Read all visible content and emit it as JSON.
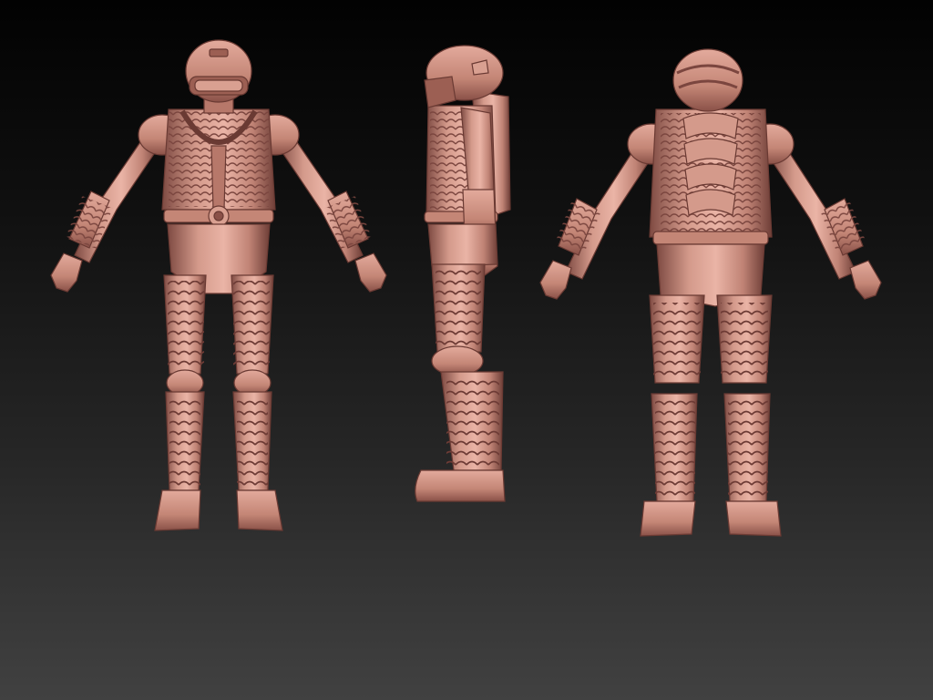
{
  "scene": {
    "material_color": "#c98a7c",
    "material_highlight": "#eab4a6",
    "material_shadow": "#7e4a42",
    "background_top": "#020202",
    "background_bottom": "#414141"
  },
  "views": [
    {
      "name": "front"
    },
    {
      "name": "side"
    },
    {
      "name": "back"
    }
  ]
}
